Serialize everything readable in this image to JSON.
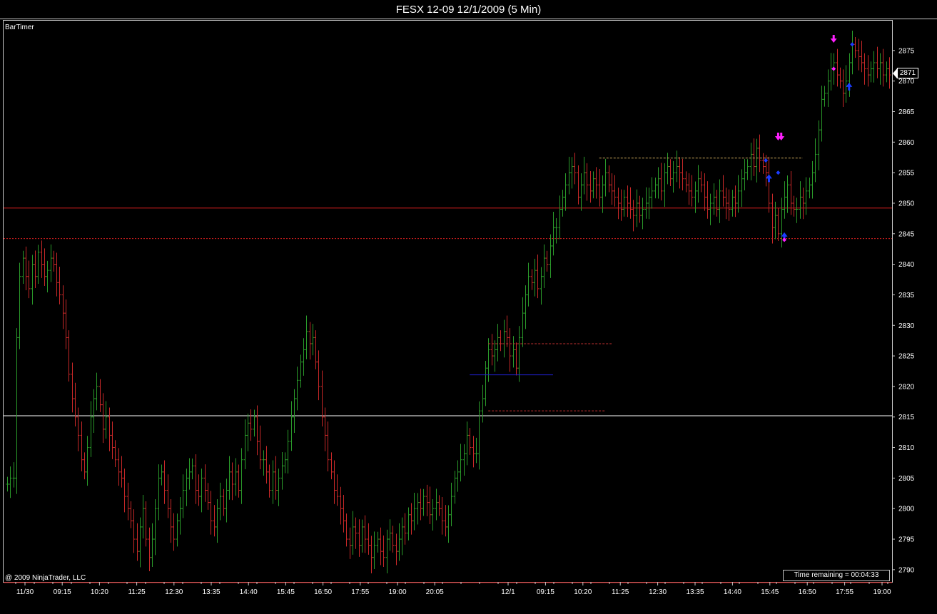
{
  "window": {
    "title": "FESX 12-09  12/1/2009 (5 Min)"
  },
  "panel": {
    "indicator_label": "BarTimer",
    "copyright": "@ 2009 NinjaTrader, LLC",
    "time_remaining": "Time remaining = 00:04:33",
    "last_price_tag": "2871"
  },
  "colors": {
    "background": "#000000",
    "up_bar": "#2a9a2a",
    "down_bar": "#c82828",
    "axis": "#c8c8c8",
    "resistance_line": "#e02020",
    "pivot_line": "#ffffff",
    "range_line_blue": "#2020d0",
    "range_dashed": "#c03030",
    "range_dashed_top": "#d4b060",
    "signal_magenta": "#ff20ff",
    "signal_blue": "#1a3cff"
  },
  "chart_data": {
    "type": "ohlc",
    "title": "FESX 12-09  12/1/2009 (5 Min)",
    "ylim": [
      2788,
      2880
    ],
    "y_ticks": [
      2790,
      2795,
      2800,
      2805,
      2810,
      2815,
      2820,
      2825,
      2830,
      2835,
      2840,
      2845,
      2850,
      2855,
      2860,
      2865,
      2870,
      2875
    ],
    "x_ticks": [
      "11/30",
      "09:15",
      "10:20",
      "11:25",
      "12:30",
      "13:35",
      "14:40",
      "15:45",
      "16:50",
      "17:55",
      "19:00",
      "20:05",
      "12/1",
      "09:15",
      "10:20",
      "11:25",
      "12:30",
      "13:35",
      "14:40",
      "15:45",
      "16:50",
      "17:55",
      "19:00"
    ],
    "close_path": [
      2804,
      2805,
      2805,
      2828,
      2838,
      2841,
      2838,
      2836,
      2840,
      2838,
      2842,
      2840,
      2838,
      2839,
      2841,
      2840,
      2837,
      2835,
      2832,
      2828,
      2822,
      2818,
      2815,
      2812,
      2808,
      2806,
      2810,
      2815,
      2818,
      2820,
      2817,
      2813,
      2815,
      2812,
      2810,
      2808,
      2806,
      2805,
      2802,
      2800,
      2798,
      2795,
      2793,
      2797,
      2800,
      2795,
      2792,
      2795,
      2800,
      2805,
      2806,
      2803,
      2800,
      2797,
      2795,
      2798,
      2800,
      2803,
      2805,
      2806,
      2807,
      2803,
      2802,
      2805,
      2803,
      2801,
      2798,
      2797,
      2800,
      2802,
      2800,
      2803,
      2806,
      2804,
      2806,
      2803,
      2808,
      2812,
      2814,
      2813,
      2815,
      2811,
      2808,
      2808,
      2806,
      2803,
      2806,
      2803,
      2805,
      2807,
      2808,
      2811,
      2815,
      2818,
      2821,
      2824,
      2826,
      2829,
      2827,
      2828,
      2824,
      2820,
      2815,
      2812,
      2808,
      2806,
      2803,
      2802,
      2800,
      2798,
      2795,
      2794,
      2797,
      2796,
      2794,
      2797,
      2795,
      2794,
      2792,
      2794,
      2795,
      2793,
      2792,
      2795,
      2796,
      2794,
      2793,
      2795,
      2797,
      2796,
      2799,
      2798,
      2800,
      2801,
      2800,
      2802,
      2801,
      2799,
      2800,
      2801,
      2800,
      2798,
      2797,
      2799,
      2802,
      2805,
      2806,
      2808,
      2809,
      2812,
      2810,
      2809,
      2809,
      2816,
      2818,
      2823,
      2826,
      2825,
      2826,
      2828,
      2827,
      2829,
      2828,
      2825,
      2826,
      2823,
      2828,
      2832,
      2835,
      2838,
      2837,
      2839,
      2836,
      2838,
      2841,
      2840,
      2843,
      2846,
      2846,
      2849,
      2851,
      2853,
      2855,
      2856,
      2855,
      2851,
      2853,
      2855,
      2853,
      2852,
      2854,
      2853,
      2851,
      2853,
      2855,
      2853,
      2852,
      2851,
      2850,
      2849,
      2851,
      2850,
      2849,
      2848,
      2850,
      2848,
      2849,
      2850,
      2851,
      2852,
      2853,
      2854,
      2852,
      2855,
      2856,
      2854,
      2855,
      2856,
      2855,
      2854,
      2853,
      2852,
      2851,
      2852,
      2854,
      2853,
      2851,
      2849,
      2850,
      2851,
      2849,
      2852,
      2851,
      2850,
      2849,
      2851,
      2850,
      2852,
      2854,
      2855,
      2856,
      2858,
      2856,
      2859,
      2857,
      2856,
      2855,
      2850,
      2846,
      2848,
      2845,
      2849,
      2851,
      2853,
      2850,
      2849,
      2849,
      2851,
      2850,
      2852,
      2853,
      2855,
      2858,
      2862,
      2867,
      2868,
      2870,
      2872,
      2873,
      2871,
      2870,
      2868,
      2870,
      2873,
      2876,
      2875,
      2874,
      2873,
      2872,
      2871,
      2872,
      2873,
      2872,
      2873,
      2871,
      2872,
      2871
    ],
    "horizontal_levels": [
      {
        "price": 2849.2,
        "style": "solid",
        "color": "#e02020"
      },
      {
        "price": 2844.2,
        "style": "dotted",
        "color": "#e02020"
      },
      {
        "price": 2815.2,
        "style": "solid",
        "color": "#ffffff"
      },
      {
        "price": 2787.9,
        "style": "solid",
        "color": "#e02020"
      }
    ],
    "segments": [
      {
        "price": 2821.9,
        "from_bar": 150,
        "to_bar": 177,
        "style": "solid",
        "color": "#2020d0"
      },
      {
        "price": 2827.0,
        "from_bar": 156,
        "to_bar": 196,
        "style": "dashed",
        "color": "#c03030"
      },
      {
        "price": 2816.0,
        "from_bar": 156,
        "to_bar": 194,
        "style": "dashed",
        "color": "#c03030"
      },
      {
        "price": 2857.4,
        "from_bar": 192,
        "to_bar": 258,
        "style": "dashed",
        "color": "#d4b060"
      }
    ],
    "signals": [
      {
        "bar": 250,
        "price": 2860.5,
        "kind": "arrow-down",
        "color": "#ff20ff"
      },
      {
        "bar": 251,
        "price": 2860.5,
        "kind": "arrow-down",
        "color": "#ff20ff"
      },
      {
        "bar": 247,
        "price": 2854.5,
        "kind": "arrow-up",
        "color": "#1a3cff"
      },
      {
        "bar": 252,
        "price": 2845.0,
        "kind": "arrow-up",
        "color": "#1a3cff"
      },
      {
        "bar": 268,
        "price": 2876.5,
        "kind": "arrow-down",
        "color": "#ff20ff"
      },
      {
        "bar": 273,
        "price": 2869.5,
        "kind": "arrow-up",
        "color": "#1a3cff"
      },
      {
        "bar": 246,
        "price": 2857.0,
        "kind": "dot",
        "color": "#1a3cff"
      },
      {
        "bar": 250,
        "price": 2855.0,
        "kind": "dot",
        "color": "#1a3cff"
      },
      {
        "bar": 252,
        "price": 2844.0,
        "kind": "dot",
        "color": "#ff20ff"
      },
      {
        "bar": 268,
        "price": 2872.0,
        "kind": "dot",
        "color": "#ff20ff"
      },
      {
        "bar": 274,
        "price": 2876.0,
        "kind": "dot",
        "color": "#1a3cff"
      }
    ]
  }
}
